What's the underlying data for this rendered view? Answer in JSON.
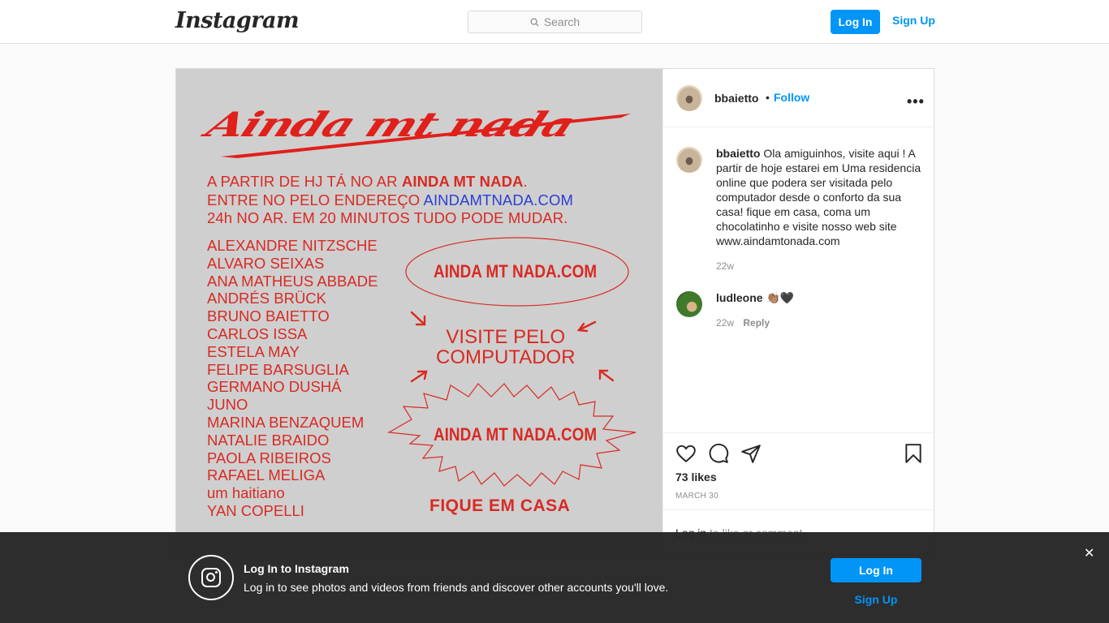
{
  "header": {
    "logo": "Instagram",
    "search_placeholder": "Search",
    "login_label": "Log In",
    "signup_label": "Sign Up"
  },
  "poster": {
    "title": "Ainda mt nada",
    "intro_line1_a": "A PARTIR DE HJ TÁ NO AR ",
    "intro_line1_b": "AINDA MT NADA",
    "intro_line1_c": ".",
    "intro_line2_a": "ENTRE NO PELO ENDEREÇO ",
    "intro_line2_b": "AINDAMTNADA.COM",
    "intro_line3": "24h NO AR. EM 20 MINUTOS TUDO PODE MUDAR.",
    "names": [
      "ALEXANDRE NITZSCHE",
      "ALVARO SEIXAS",
      "ANA MATHEUS ABBADE",
      "ANDRÉS BRÜCK",
      "BRUNO BAIETTO",
      "CARLOS ISSA",
      "ESTELA MAY",
      "FELIPE BARSUGLIA",
      "GERMANO DUSHÁ",
      "JUNO",
      "MARINA BENZAQUEM",
      "NATALIE BRAIDO",
      "PAOLA RIBEIROS",
      "RAFAEL MELIGA",
      "um haitiano",
      "YAN COPELLI"
    ],
    "ellipse_text": "AINDA MT NADA.COM",
    "visit_line1": "VISITE PELO",
    "visit_line2": "COMPUTADOR",
    "burst_text": "AINDA MT NADA.COM",
    "footer": "FIQUE EM CASA"
  },
  "post": {
    "username": "bbaietto",
    "follow_label": "Follow",
    "separator": "•",
    "more": "•••",
    "caption_user": "bbaietto",
    "caption_text": "Ola amiguinhos, visite aqui ! A partir de hoje estarei em Uma residencia online que podera ser visitada pelo computador desde o conforto da sua casa! fique em casa, coma um chocolatinho e visite nosso web site www.aindamtonada.com",
    "caption_age": "22w",
    "comment_user": "ludleone",
    "comment_text": "👏🏽🖤",
    "comment_age": "22w",
    "reply_label": "Reply",
    "likes": "73 likes",
    "date": "MARCH 30",
    "login_link": "Log in",
    "login_rest": " to like or comment."
  },
  "banner": {
    "title": "Log In to Instagram",
    "subtitle": "Log in to see photos and videos from friends and discover other accounts you'll love.",
    "login_label": "Log In",
    "signup_label": "Sign Up",
    "close": "✕"
  },
  "colors": {
    "accent": "#0095f6",
    "poster_red": "#d82a23",
    "poster_bg": "#cfcfcf"
  }
}
